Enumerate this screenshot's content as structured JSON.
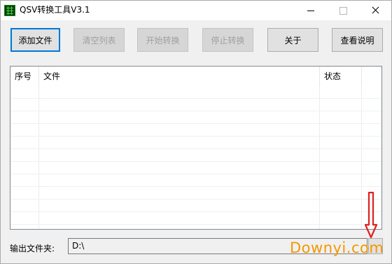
{
  "window": {
    "title": "QSV转换工具V3.1",
    "app_icon": "qsv-app-icon",
    "controls": [
      "minimize-icon",
      "maximize-icon",
      "close-icon"
    ]
  },
  "toolbar": {
    "add_file": "添加文件",
    "clear_list": "清空列表",
    "start_convert": "开始转换",
    "stop_convert": "停止转换",
    "about": "关于",
    "view_help": "查看说明"
  },
  "file_list": {
    "columns": [
      "序号",
      "文件",
      "状态"
    ],
    "rows": []
  },
  "output": {
    "label": "输出文件夹:",
    "value": "D:\\"
  },
  "watermark": {
    "text": "Downyi.com",
    "color": "#f39800",
    "arrow_color": "#e02020"
  },
  "colors": {
    "focus": "#0078d7",
    "disabled_text": "#a0a0a0"
  }
}
